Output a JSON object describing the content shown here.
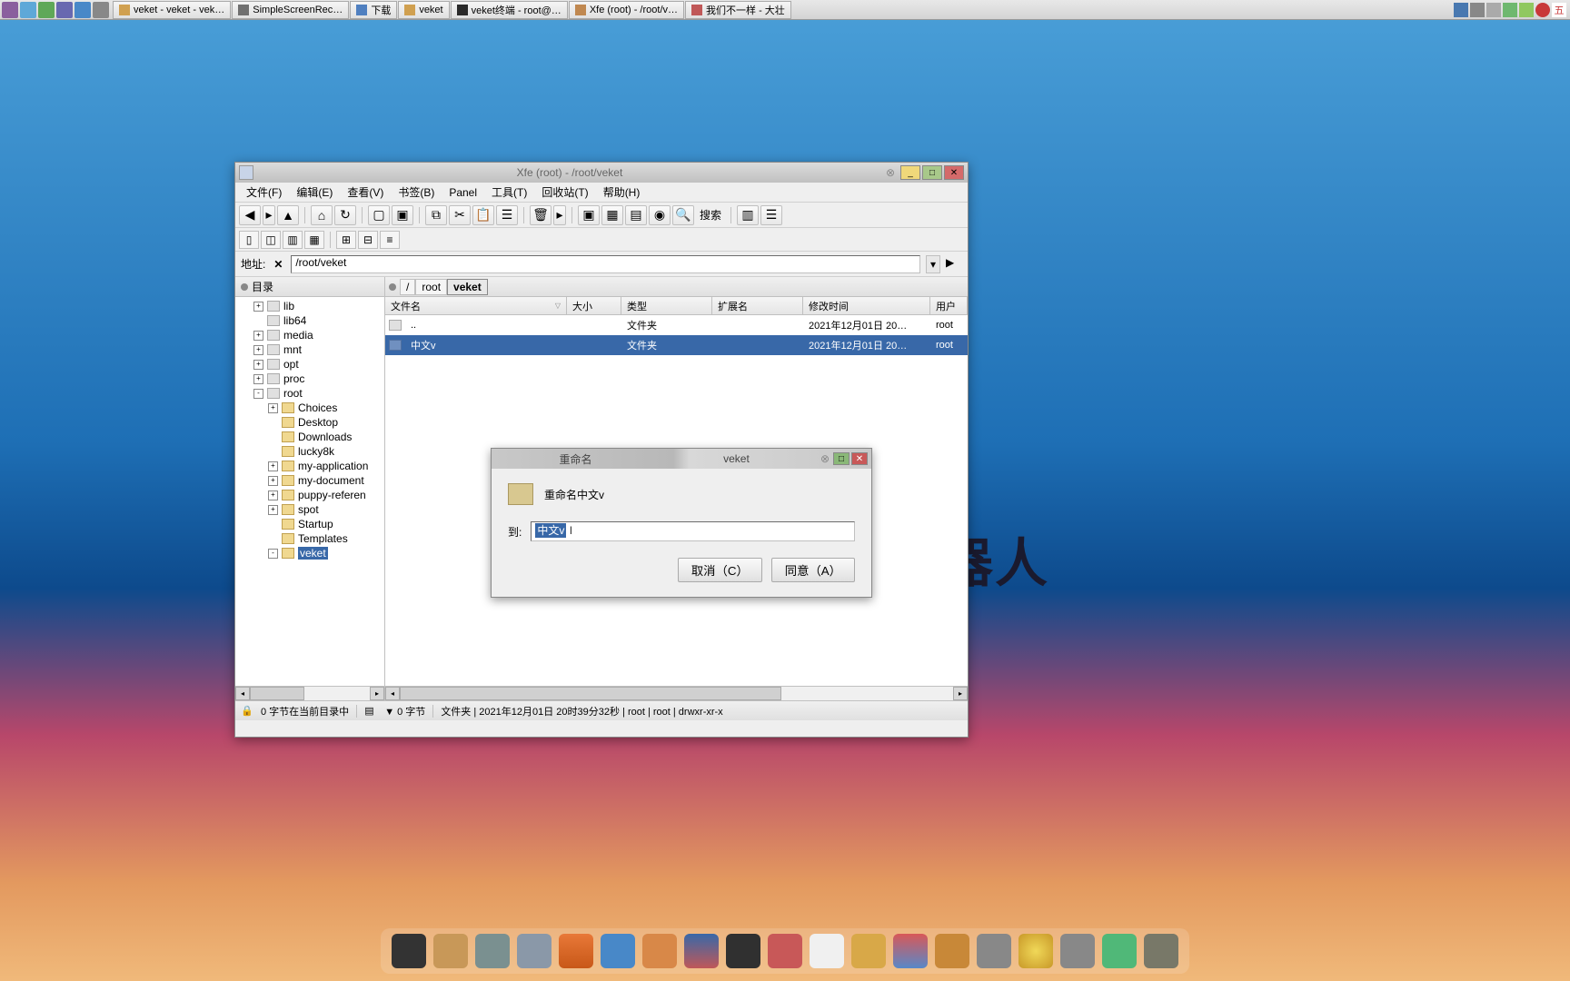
{
  "taskbar": {
    "tasks": [
      {
        "label": "veket - veket - vek…"
      },
      {
        "label": "SimpleScreenRec…"
      },
      {
        "label": "下载"
      },
      {
        "label": "veket"
      },
      {
        "label": "veket终端 - root@…"
      },
      {
        "label": "Xfe (root) - /root/v…"
      },
      {
        "label": "我们不一样 - 大壮"
      }
    ]
  },
  "desktop": {
    "text_fragment": "智能机器人"
  },
  "xfe": {
    "title": "Xfe (root) - /root/veket",
    "menu": {
      "file": "文件(F)",
      "edit": "编辑(E)",
      "view": "查看(V)",
      "bookmarks": "书签(B)",
      "panel": "Panel",
      "tools": "工具(T)",
      "trash": "回收站(T)",
      "help": "帮助(H)"
    },
    "toolbar_search": "搜索",
    "address": {
      "label": "地址:",
      "value": "/root/veket"
    },
    "dirtree": {
      "header": "目录",
      "items": [
        {
          "label": "lib",
          "toggle": "+",
          "indent": 1,
          "gray": true
        },
        {
          "label": "lib64",
          "toggle": "",
          "indent": 1,
          "gray": true
        },
        {
          "label": "media",
          "toggle": "+",
          "indent": 1,
          "gray": true
        },
        {
          "label": "mnt",
          "toggle": "+",
          "indent": 1,
          "gray": true
        },
        {
          "label": "opt",
          "toggle": "+",
          "indent": 1,
          "gray": true
        },
        {
          "label": "proc",
          "toggle": "+",
          "indent": 1,
          "gray": true
        },
        {
          "label": "root",
          "toggle": "-",
          "indent": 1,
          "gray": true
        },
        {
          "label": "Choices",
          "toggle": "+",
          "indent": 2,
          "gray": false
        },
        {
          "label": "Desktop",
          "toggle": "",
          "indent": 2,
          "gray": false
        },
        {
          "label": "Downloads",
          "toggle": "",
          "indent": 2,
          "gray": false
        },
        {
          "label": "lucky8k",
          "toggle": "",
          "indent": 2,
          "gray": false
        },
        {
          "label": "my-application",
          "toggle": "+",
          "indent": 2,
          "gray": false
        },
        {
          "label": "my-document",
          "toggle": "+",
          "indent": 2,
          "gray": false
        },
        {
          "label": "puppy-referen",
          "toggle": "+",
          "indent": 2,
          "gray": false
        },
        {
          "label": "spot",
          "toggle": "+",
          "indent": 2,
          "gray": false
        },
        {
          "label": "Startup",
          "toggle": "",
          "indent": 2,
          "gray": false
        },
        {
          "label": "Templates",
          "toggle": "",
          "indent": 2,
          "gray": false
        },
        {
          "label": "veket",
          "toggle": "-",
          "indent": 2,
          "gray": false,
          "selected": true
        }
      ]
    },
    "breadcrumb": {
      "slash": "/",
      "root": "root",
      "veket": "veket"
    },
    "columns": {
      "name": "文件名",
      "size": "大小",
      "type": "类型",
      "ext": "扩展名",
      "mtime": "修改时间",
      "user": "用户"
    },
    "rows": [
      {
        "name": "..",
        "type": "文件夹",
        "mtime": "2021年12月01日 20…",
        "user": "root"
      },
      {
        "name": "中文v",
        "type": "文件夹",
        "mtime": "2021年12月01日 20…",
        "user": "root",
        "selected": true
      }
    ],
    "status": {
      "left": "0 字节在当前目录中",
      "mid": "▼  0 字节",
      "details": "文件夹 | 2021年12月01日 20时39分32秒 | root | root | drwxr-xr-x"
    }
  },
  "dialog": {
    "title_left": "重命名",
    "title_right": "veket",
    "msg": "重命名中文v",
    "to_label": "到:",
    "input_value": "中文v",
    "cancel": "取消（C）",
    "ok": "同意（A）"
  }
}
